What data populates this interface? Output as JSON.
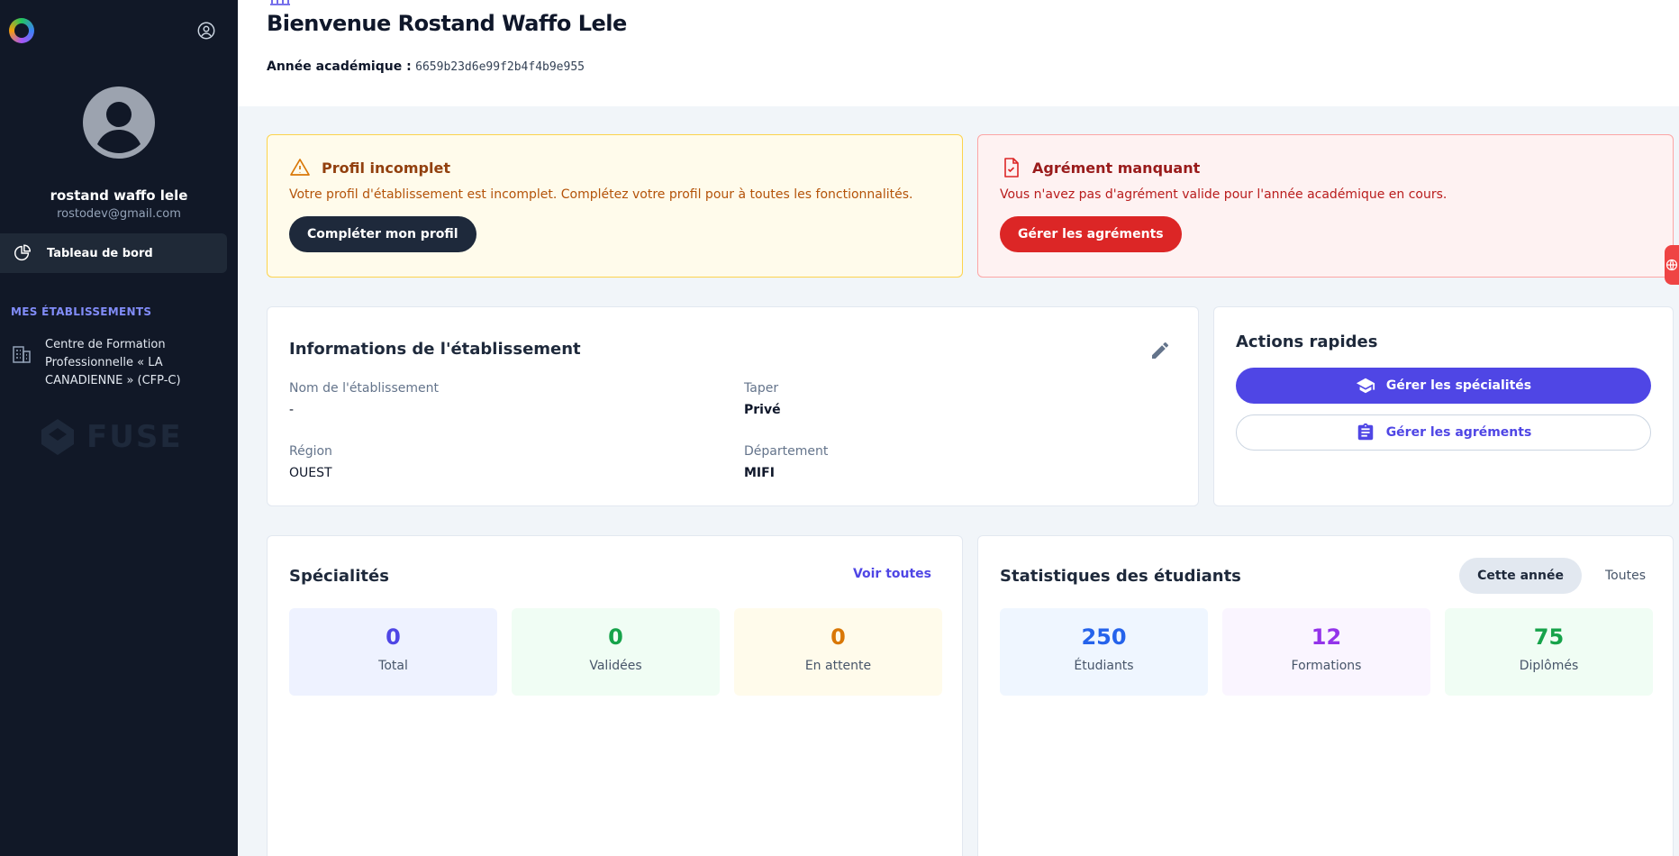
{
  "sidebar": {
    "user": {
      "name": "rostand waffo lele",
      "email": "rostodev@gmail.com"
    },
    "nav": [
      {
        "label": "Tableau de bord",
        "icon": "pie-chart-icon"
      }
    ],
    "section_title": "MES ÉTABLISSEMENTS",
    "establishments": [
      {
        "label": "Centre de Formation Professionnelle « LA CANADIENNE » (CFP-C)",
        "icon": "building-icon"
      }
    ],
    "brand": "FUSE"
  },
  "header": {
    "title": "Bienvenue Rostand Waffo Lele",
    "academic_year_label": "Année académique :",
    "academic_year_value": "6659b23d6e99f2b4f4b9e955"
  },
  "alerts": {
    "profile": {
      "title": "Profil incomplet",
      "text": "Votre profil d'établissement est incomplet. Complétez votre profil pour à toutes les fonctionnalités.",
      "button": "Compléter mon profil",
      "color": "#b45309"
    },
    "agrement": {
      "title": "Agrément manquant",
      "text": "Vous n'avez pas d'agrément valide pour l'année académique en cours.",
      "button": "Gérer les agréments",
      "color": "#dc2626"
    }
  },
  "info": {
    "title": "Informations de l'établissement",
    "fields": [
      {
        "label": "Nom de l'établissement",
        "value": "-"
      },
      {
        "label": "Taper",
        "value": "Privé"
      },
      {
        "label": "Région",
        "value": "OUEST"
      },
      {
        "label": "Département",
        "value": "MIFI"
      }
    ]
  },
  "quick_actions": {
    "title": "Actions rapides",
    "primary": "Gérer les spécialités",
    "secondary": "Gérer les agréments",
    "accent": "#4f46e5"
  },
  "specialites": {
    "title": "Spécialités",
    "link": "Voir toutes",
    "tiles": [
      {
        "value": "0",
        "label": "Total",
        "color": "#4f46e5"
      },
      {
        "value": "0",
        "label": "Validées",
        "color": "#16a34a"
      },
      {
        "value": "0",
        "label": "En attente",
        "color": "#d97706"
      }
    ]
  },
  "stats": {
    "title": "Statistiques des étudiants",
    "tabs": [
      "Cette année",
      "Toutes"
    ],
    "active_tab": "Cette année",
    "tiles": [
      {
        "value": "250",
        "label": "Étudiants",
        "color": "#2563eb"
      },
      {
        "value": "12",
        "label": "Formations",
        "color": "#9333ea"
      },
      {
        "value": "75",
        "label": "Diplômés",
        "color": "#16a34a"
      }
    ]
  }
}
